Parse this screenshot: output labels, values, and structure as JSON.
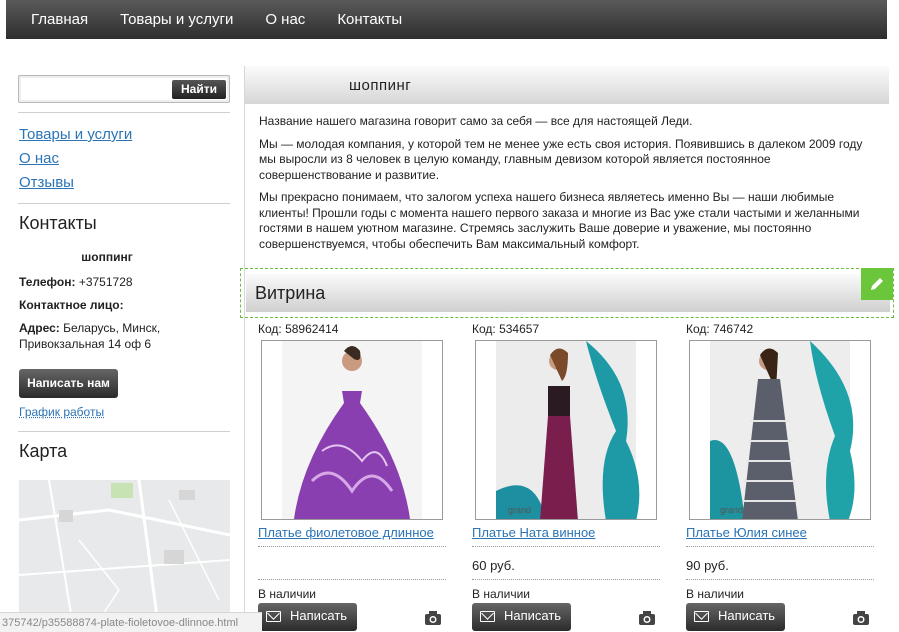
{
  "nav": {
    "items": [
      "Главная",
      "Товары и услуги",
      "О нас",
      "Контакты"
    ]
  },
  "sidebar": {
    "search_placeholder": "",
    "search_button": "Найти",
    "links": [
      "Товары и услуги",
      "О нас",
      "Отзывы"
    ],
    "contacts_heading": "Контакты",
    "shop_name": "шоппинг",
    "phone_label": "Телефон:",
    "phone_value": "+3751728",
    "contact_person_label": "Контактное лицо:",
    "address_label": "Адрес:",
    "address_value": "Беларусь, Минск, Привокзальная 14 оф 6",
    "write_button": "Написать нам",
    "schedule_link": "График работы",
    "map_heading": "Карта"
  },
  "main": {
    "header_title": "шоппинг",
    "paragraphs": [
      "Название нашего магазина говорит само за себя — все для настоящей Леди.",
      "Мы — молодая компания, у которой тем не менее уже есть своя история.  Появившись в далеком 2009 году мы выросли из 8 человек в целую команду, главным девизом которой является постоянное совершенствование и развитие.",
      "Мы прекрасно понимаем, что залогом успеха нашего бизнеса являетесь именно Вы — наши любимые клиенты! Прошли годы с момента нашего первого заказа и многие из Вас уже стали частыми и желанными гостями в нашем уютном магазине. Стремясь заслужить Ваше доверие и уважение, мы постоянно совершенствуемся, чтобы обеспечить Вам максимальный комфорт."
    ],
    "vitrina_title": "Витрина"
  },
  "products": [
    {
      "code": "Код: 58962414",
      "title": "Платье фиолетовое длинное",
      "price": "",
      "stock": "В наличии",
      "button": "Написать",
      "dress_color": "#8a3fb0"
    },
    {
      "code": "Код: 534657",
      "title": "Платье Ната винное",
      "price": "60   руб.",
      "stock": "В наличии",
      "button": "Написать",
      "dress_color": "#7a1e4e"
    },
    {
      "code": "Код: 746742",
      "title": "Платье Юлия синее",
      "price": "90   руб.",
      "stock": "В наличии",
      "button": "Написать",
      "dress_color": "#5a5f6b"
    }
  ],
  "status_bar": "375742/p35588874-plate-fioletovoe-dlinnoe.html",
  "colors": {
    "accent_green": "#6cc63c",
    "link_blue": "#2b74b6"
  }
}
